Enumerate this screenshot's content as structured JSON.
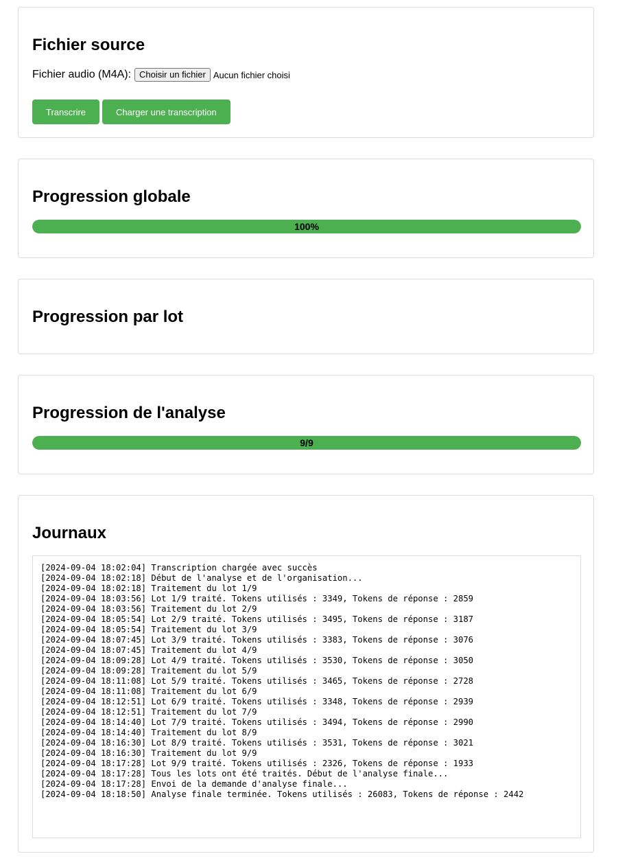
{
  "source": {
    "title": "Fichier source",
    "file_label": "Fichier audio (M4A):",
    "file_button": "Choisir un fichier",
    "file_status": "Aucun fichier choisi",
    "transcribe_button": "Transcrire",
    "load_button": "Charger une transcription"
  },
  "global_progress": {
    "title": "Progression globale",
    "percent": 100,
    "label": "100%"
  },
  "lot_progress": {
    "title": "Progression par lot"
  },
  "analysis_progress": {
    "title": "Progression de l'analyse",
    "done": 9,
    "total": 9,
    "label": "9/9"
  },
  "logs": {
    "title": "Journaux",
    "lines": [
      "[2024-09-04 18:02:04] Transcription chargée avec succès",
      "[2024-09-04 18:02:18] Début de l'analyse et de l'organisation...",
      "[2024-09-04 18:02:18] Traitement du lot 1/9",
      "[2024-09-04 18:03:56] Lot 1/9 traité. Tokens utilisés : 3349, Tokens de réponse : 2859",
      "[2024-09-04 18:03:56] Traitement du lot 2/9",
      "[2024-09-04 18:05:54] Lot 2/9 traité. Tokens utilisés : 3495, Tokens de réponse : 3187",
      "[2024-09-04 18:05:54] Traitement du lot 3/9",
      "[2024-09-04 18:07:45] Lot 3/9 traité. Tokens utilisés : 3383, Tokens de réponse : 3076",
      "[2024-09-04 18:07:45] Traitement du lot 4/9",
      "[2024-09-04 18:09:28] Lot 4/9 traité. Tokens utilisés : 3530, Tokens de réponse : 3050",
      "[2024-09-04 18:09:28] Traitement du lot 5/9",
      "[2024-09-04 18:11:08] Lot 5/9 traité. Tokens utilisés : 3465, Tokens de réponse : 2728",
      "[2024-09-04 18:11:08] Traitement du lot 6/9",
      "[2024-09-04 18:12:51] Lot 6/9 traité. Tokens utilisés : 3348, Tokens de réponse : 2939",
      "[2024-09-04 18:12:51] Traitement du lot 7/9",
      "[2024-09-04 18:14:40] Lot 7/9 traité. Tokens utilisés : 3494, Tokens de réponse : 2990",
      "[2024-09-04 18:14:40] Traitement du lot 8/9",
      "[2024-09-04 18:16:30] Lot 8/9 traité. Tokens utilisés : 3531, Tokens de réponse : 3021",
      "[2024-09-04 18:16:30] Traitement du lot 9/9",
      "[2024-09-04 18:17:28] Lot 9/9 traité. Tokens utilisés : 2326, Tokens de réponse : 1933",
      "[2024-09-04 18:17:28] Tous les lots ont été traités. Début de l'analyse finale...",
      "[2024-09-04 18:17:28] Envoi de la demande d'analyse finale...",
      "[2024-09-04 18:18:50] Analyse finale terminée. Tokens utilisés : 26083, Tokens de réponse : 2442"
    ]
  },
  "colors": {
    "accent": "#4caf50",
    "track": "#e0e0e0",
    "border": "#dcdcdc"
  }
}
